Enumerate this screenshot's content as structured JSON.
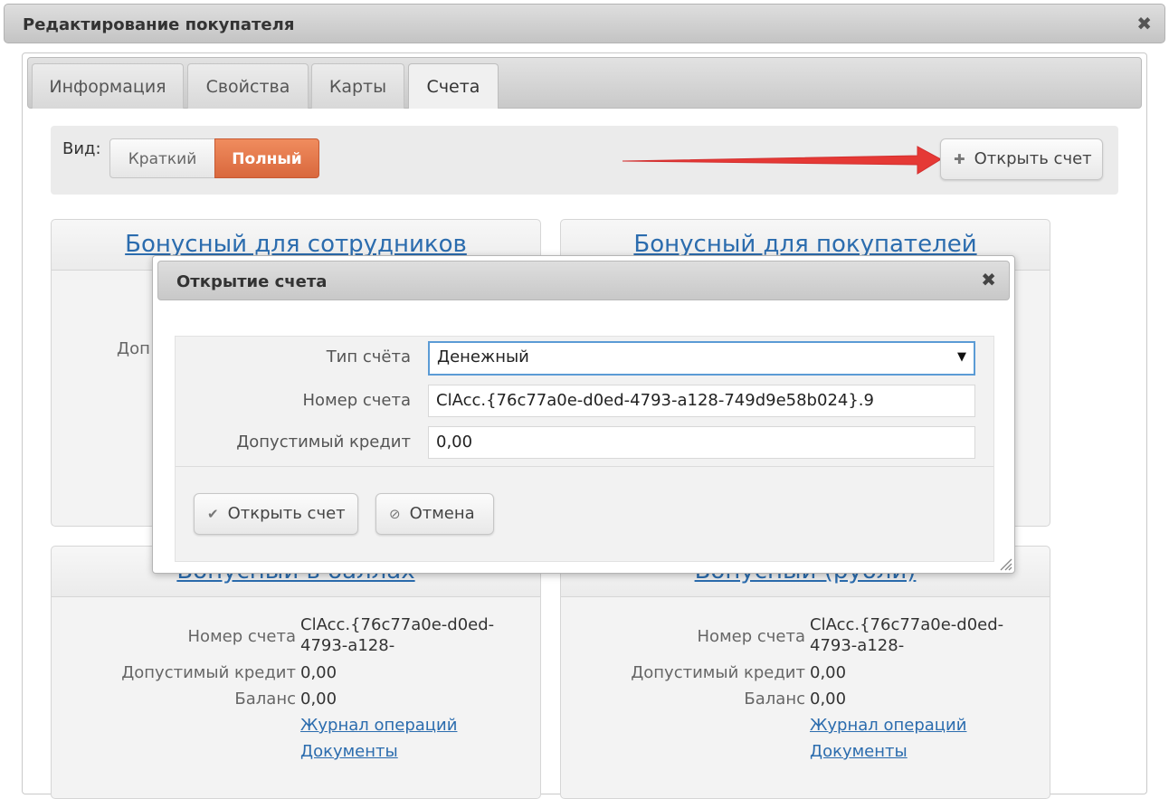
{
  "window": {
    "title": "Редактирование покупателя",
    "close_glyph": "✖"
  },
  "tabs": [
    {
      "label": "Информация",
      "active": false
    },
    {
      "label": "Свойства",
      "active": false
    },
    {
      "label": "Карты",
      "active": false
    },
    {
      "label": "Счета",
      "active": true
    }
  ],
  "toolbar": {
    "view_label": "Вид:",
    "view_short": "Краткий",
    "view_full": "Полный",
    "open_account_label": "Открыть счет"
  },
  "cards": [
    {
      "title": "Бонусный для сотрудников",
      "partial_label": "Доп"
    },
    {
      "title": "Бонусный для покупателей"
    },
    {
      "title": "Бонусный в баллах",
      "number_label": "Номер счета",
      "number_value_line1": "ClAcc.{76c77a0e-d0ed-",
      "number_value_line2": "4793-a128-",
      "credit_label": "Допустимый кредит",
      "credit_value": "0,00",
      "balance_label": "Баланс",
      "balance_value": "0,00",
      "journal_link": "Журнал операций",
      "documents_link": "Документы"
    },
    {
      "title": "Бонусный (рубли)",
      "number_label": "Номер счета",
      "number_value_line1": "ClAcc.{76c77a0e-d0ed-",
      "number_value_line2": "4793-a128-",
      "credit_label": "Допустимый кредит",
      "credit_value": "0,00",
      "balance_label": "Баланс",
      "balance_value": "0,00",
      "journal_link": "Журнал операций",
      "documents_link": "Документы"
    }
  ],
  "modal": {
    "title": "Открытие счета",
    "close_glyph": "✖",
    "type_label": "Тип счёта",
    "type_value": "Денежный",
    "number_label": "Номер счета",
    "number_value": "ClAcc.{76c77a0e-d0ed-4793-a128-749d9e58b024}.9",
    "credit_label": "Допустимый кредит",
    "credit_value": "0,00",
    "ok_label": "Открыть счет",
    "cancel_label": "Отмена"
  },
  "colors": {
    "accent": "#e0703f",
    "link": "#2b6cae",
    "arrow": "#e53935"
  }
}
